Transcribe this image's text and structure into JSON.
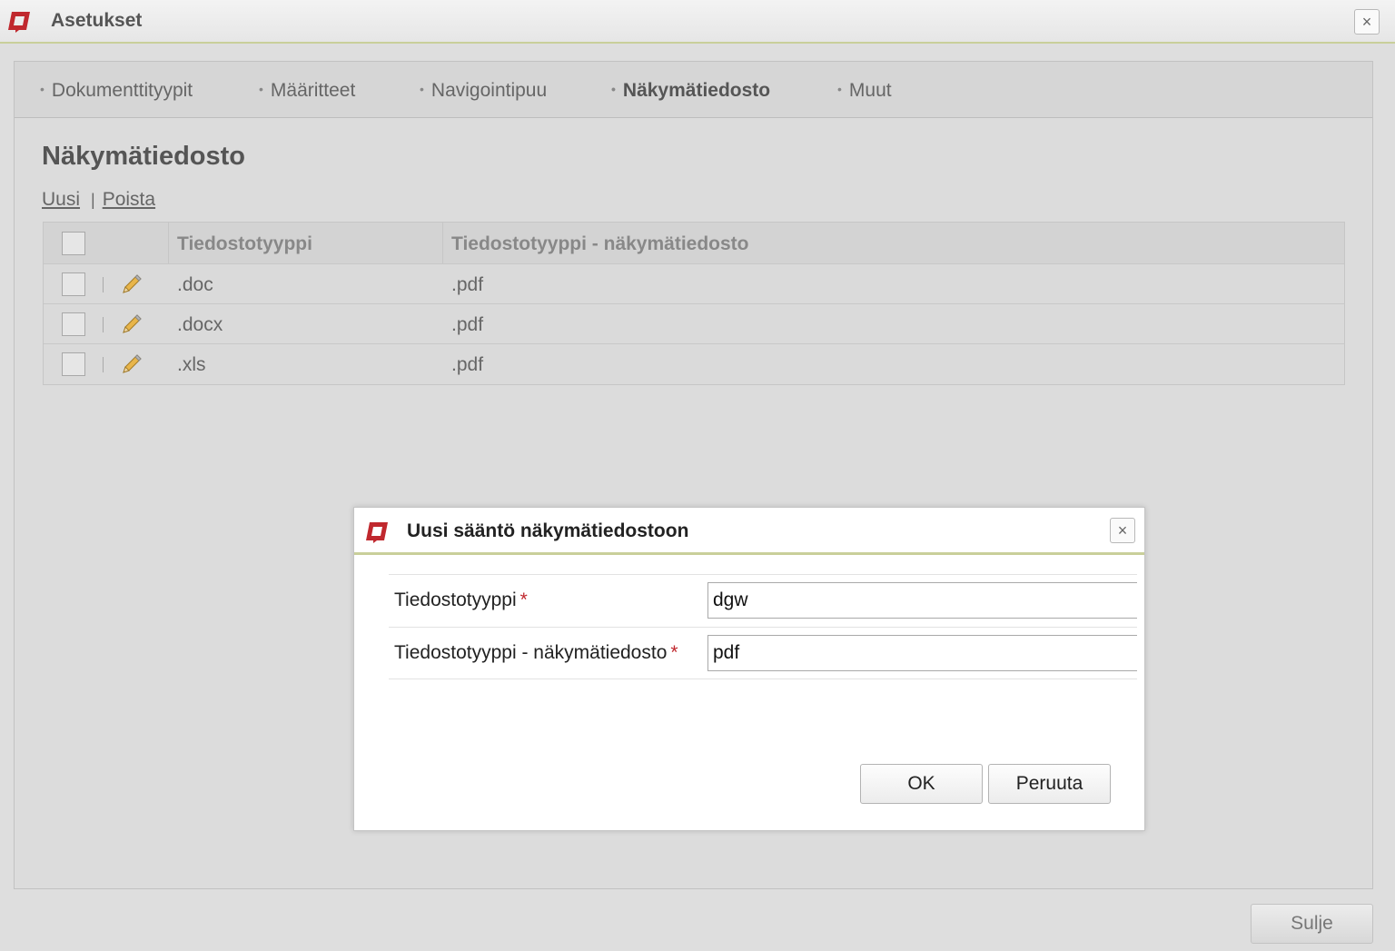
{
  "window": {
    "title": "Asetukset",
    "close_icon": "×"
  },
  "tabs": [
    {
      "label": "Dokumenttityypit",
      "active": false
    },
    {
      "label": "Määritteet",
      "active": false
    },
    {
      "label": "Navigointipuu",
      "active": false
    },
    {
      "label": "Näkymätiedosto",
      "active": true
    },
    {
      "label": "Muut",
      "active": false
    }
  ],
  "bullet": "•",
  "page": {
    "title": "Näkymätiedosto",
    "new_link": "Uusi",
    "separator": "|",
    "delete_link": "Poista"
  },
  "table": {
    "headers": [
      "Tiedostotyyppi",
      "Tiedostotyyppi - näkymätiedosto"
    ],
    "rows": [
      {
        "type": ".doc",
        "view": ".pdf"
      },
      {
        "type": ".docx",
        "view": ".pdf"
      },
      {
        "type": ".xls",
        "view": ".pdf"
      }
    ]
  },
  "dialog": {
    "title": "Uusi sääntö näkymätiedostoon",
    "close_icon": "×",
    "fields": [
      {
        "label": "Tiedostotyyppi",
        "value": "dgw",
        "required_mark": "*"
      },
      {
        "label": "Tiedostotyyppi - näkymätiedosto",
        "value": "pdf",
        "required_mark": "*"
      }
    ],
    "ok_label": "OK",
    "cancel_label": "Peruuta"
  },
  "footer": {
    "close_label": "Sulje"
  },
  "colors": {
    "brand_red": "#c0282e",
    "accent_line": "#c9cf9a",
    "pencil": "#e8b54a"
  },
  "icons": {
    "app_logo": "app-logo-icon",
    "edit": "pencil-icon",
    "close": "close-icon"
  }
}
